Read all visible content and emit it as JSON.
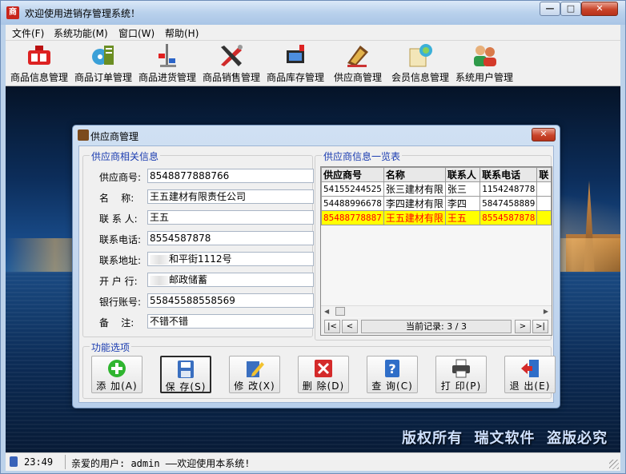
{
  "window": {
    "title": "欢迎使用进销存管理系统！",
    "app_icon_text": "商"
  },
  "window_controls": {
    "minimize": "—",
    "maximize": "□",
    "close": "✕"
  },
  "menu": [
    "文件(F)",
    "系统功能(M)",
    "窗口(W)",
    "帮助(H)"
  ],
  "toolbar": [
    {
      "label": "商品信息管理",
      "icon": "product-info-icon"
    },
    {
      "label": "商品订单管理",
      "icon": "order-icon"
    },
    {
      "label": "商品进货管理",
      "icon": "purchase-icon"
    },
    {
      "label": "商品销售管理",
      "icon": "sales-icon"
    },
    {
      "label": "商品库存管理",
      "icon": "inventory-icon"
    },
    {
      "label": "供应商管理",
      "icon": "supplier-icon"
    },
    {
      "label": "会员信息管理",
      "icon": "member-icon"
    },
    {
      "label": "系统用户管理",
      "icon": "system-user-icon"
    }
  ],
  "dialog": {
    "title": "供应商管理",
    "close": "✕",
    "info_group_title": "供应商相关信息",
    "fields": [
      {
        "label": "供应商号:",
        "value": "8548877888766"
      },
      {
        "label": "名    称:",
        "value": "王五建材有限责任公司"
      },
      {
        "label": "联 系 人:",
        "value": "王五"
      },
      {
        "label": "联系电话:",
        "value": "8554587878"
      },
      {
        "label": "联系地址:",
        "value": "和平街1112号"
      },
      {
        "label": "开 户 行:",
        "value": "邮政储蓄"
      },
      {
        "label": "银行账号:",
        "value": "55845588558569"
      },
      {
        "label": "备    注:",
        "value": "不错不错"
      }
    ],
    "list_group_title": "供应商信息一览表",
    "table": {
      "columns": [
        "供应商号",
        "名称",
        "联系人",
        "联系电话",
        "联"
      ],
      "rows": [
        [
          "54155244525",
          "张三建材有限",
          "张三",
          "1154248778",
          ""
        ],
        [
          "54488996678",
          "李四建材有限",
          "李四",
          "5847458889",
          ""
        ],
        [
          "85488778887",
          "王五建材有限",
          "王五",
          "8554587878",
          ""
        ]
      ],
      "selected_row": 2
    },
    "nav": {
      "first": "|<",
      "prev": "<",
      "caption": "当前记录: 3 / 3",
      "next": ">",
      "last": ">|"
    },
    "func_group_title": "功能选项",
    "buttons": [
      {
        "label": "添 加(A)",
        "icon": "add-icon"
      },
      {
        "label": "保 存(S)",
        "icon": "save-icon"
      },
      {
        "label": "修 改(X)",
        "icon": "edit-icon"
      },
      {
        "label": "删 除(D)",
        "icon": "delete-icon"
      },
      {
        "label": "查 询(C)",
        "icon": "query-icon"
      },
      {
        "label": "打 印(P)",
        "icon": "print-icon"
      },
      {
        "label": "退 出(E)",
        "icon": "exit-icon"
      }
    ]
  },
  "copyright": [
    "版权所有",
    "瑞文软件",
    "盗版必究"
  ],
  "status": {
    "time": "23:49",
    "message": "亲爱的用户: admin ——欢迎使用本系统!"
  },
  "colors": {
    "selected_row_bg": "#ffff00",
    "selected_row_text": "#ff0000",
    "group_title": "#1a3cb0"
  }
}
